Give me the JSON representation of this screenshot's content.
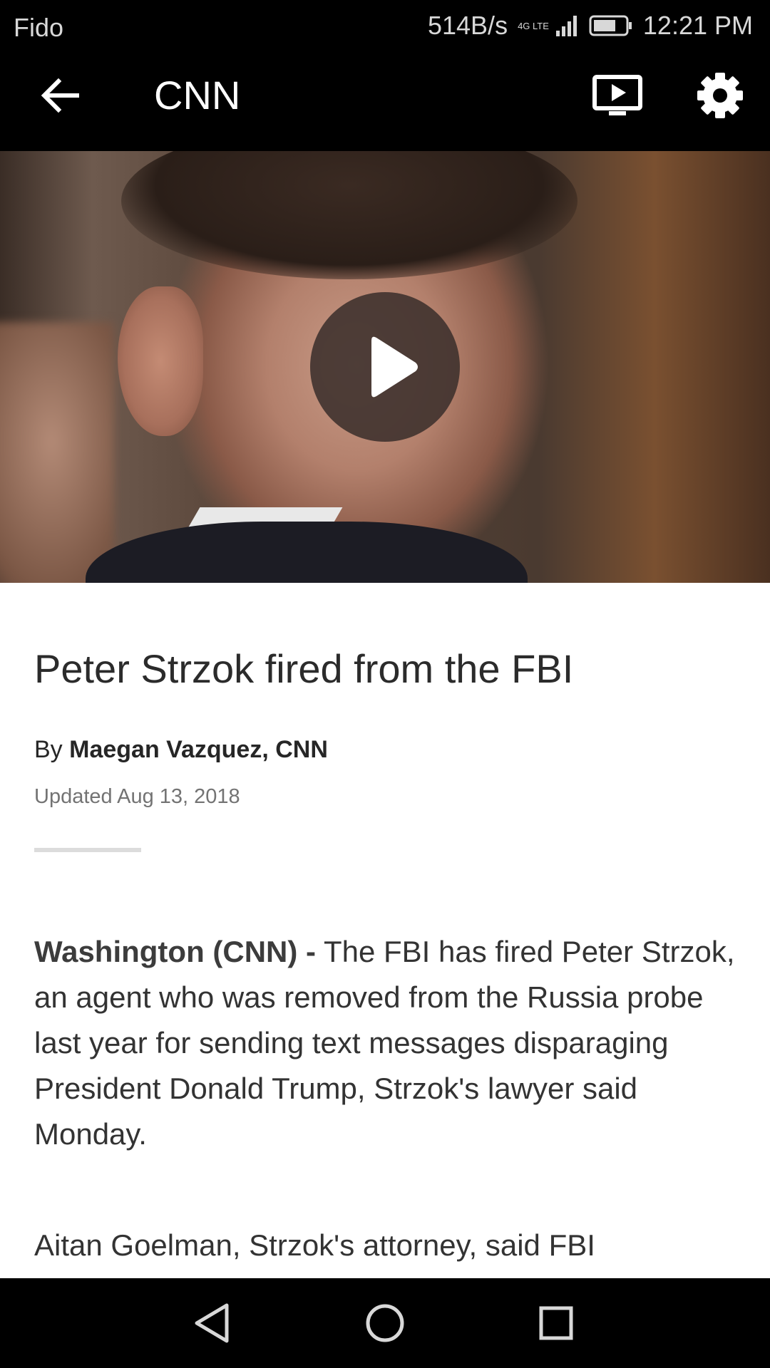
{
  "status_bar": {
    "carrier": "Fido",
    "network_speed": "514B/s",
    "network_type": "4G LTE",
    "time": "12:21 PM",
    "icons": [
      "signal-icon",
      "battery-icon"
    ]
  },
  "app_bar": {
    "title": "CNN",
    "icons": [
      "back-arrow-icon",
      "cast-tv-icon",
      "settings-gear-icon"
    ]
  },
  "hero": {
    "icon": "play-icon"
  },
  "article": {
    "headline": "Peter Strzok fired from the FBI",
    "byline_prefix": "By",
    "byline_author": "Maegan Vazquez, CNN",
    "updated": "Updated Aug 13, 2018",
    "dateline": "Washington  (CNN) -",
    "paragraph1": "The FBI has fired Peter Strzok, an agent who was removed from the Russia probe last year for sending text messages disparaging President Donald Trump, Strzok's lawyer said Monday.",
    "paragraph2": "Aitan Goelman, Strzok's attorney, said FBI"
  },
  "nav_bar": {
    "icons": [
      "back-triangle-icon",
      "home-circle-icon",
      "recents-square-icon"
    ]
  }
}
